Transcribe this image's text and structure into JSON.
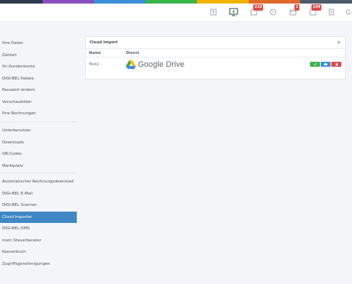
{
  "colors": {
    "strip": [
      "#2f3b4c",
      "#8a4fbf",
      "#3a8fd8",
      "#3bb54a",
      "#f0b400",
      "#e06a2a",
      "#4c5a6c"
    ],
    "accent": "#3f88c5",
    "edit": "#3db34a",
    "cloud": "#3a8fd8",
    "delete": "#e04848"
  },
  "topbar": {
    "icons": [
      {
        "name": "upload-icon"
      },
      {
        "name": "monitor-download-icon"
      },
      {
        "name": "inbox-icon",
        "badge": "219"
      },
      {
        "name": "help-icon"
      },
      {
        "name": "calendar-icon",
        "badge": "1"
      },
      {
        "name": "invoices-icon",
        "badge": "249"
      },
      {
        "name": "document-icon"
      },
      {
        "name": "refresh-icon"
      }
    ]
  },
  "sidebar": {
    "group1": [
      "Ihre Daten",
      "Zahlart",
      "Ihr Kundenkonto",
      "DIGI-BEL Pakete",
      "Passwort ändern",
      "Vorschaubilder",
      "Ihre Rechnungen"
    ],
    "group2": [
      "Unterbenutzer",
      "Downloads",
      "QR-Codes",
      "Marktplatz"
    ],
    "group3": [
      "Automatischer Rechnungsdownload",
      "DIGI-BEL E-Mail",
      "DIGI-BEL Scanner",
      "Cloud Importer",
      "DIGI-BEL DMS",
      "mein Steuerberater",
      "Kassenbuch",
      "Zugriffsgenehmigungen"
    ],
    "active": "Cloud Importer"
  },
  "panel": {
    "title": "Cloud Import",
    "add_label": "+",
    "columns": {
      "name": "Name",
      "service": "Dienst"
    },
    "rows": [
      {
        "name": "Test2",
        "service": "Google Drive"
      }
    ]
  }
}
